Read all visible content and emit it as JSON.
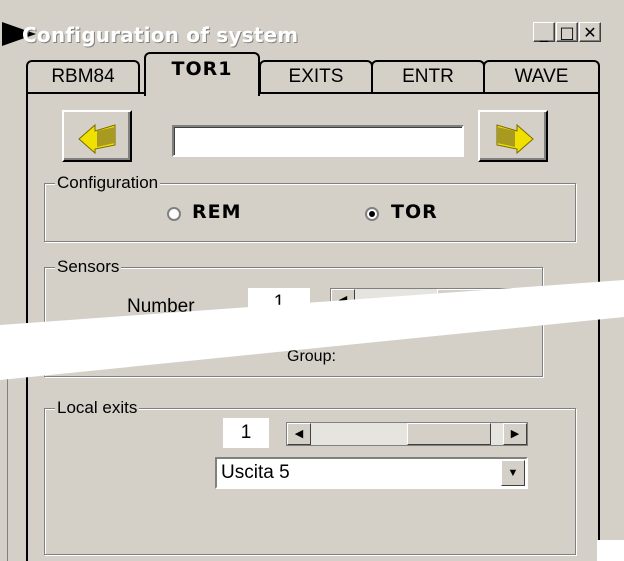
{
  "window": {
    "title": "Configuration of system",
    "minimize": "_",
    "maximize": "□",
    "close": "✕"
  },
  "tabs": [
    {
      "label": "RBM84",
      "active": false
    },
    {
      "label": "TOR1",
      "active": true
    },
    {
      "label": "EXITS",
      "active": false
    },
    {
      "label": "ENTR",
      "active": false
    },
    {
      "label": "WAVE",
      "active": false
    }
  ],
  "toolbar": {
    "prev_icon": "yellow-left-arrow-icon",
    "next_icon": "yellow-right-arrow-icon",
    "name_value": "",
    "icon_color": "#f0e000"
  },
  "configuration": {
    "label": "Configuration",
    "options": [
      {
        "label": "REM",
        "selected": false
      },
      {
        "label": "TOR",
        "selected": true
      }
    ]
  },
  "sensors": {
    "label": "Sensors",
    "number_label": "Number",
    "number_value": "1",
    "group_label_partial": "Group:"
  },
  "local_exits": {
    "label": "Local exits",
    "number_value": "1",
    "selected_exit": "Uscita 5"
  }
}
